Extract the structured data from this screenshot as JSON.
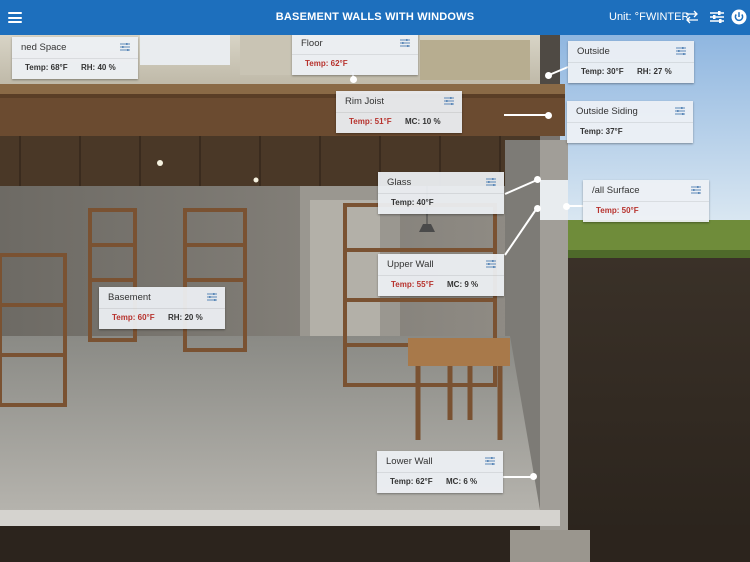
{
  "header": {
    "title": "BASEMENT WALLS WITH WINDOWS",
    "unit_label": "Unit: °F",
    "season_label": "WINTER",
    "menu_icon": "hamburger-menu-icon",
    "swap_icon": "swap-arrows-icon",
    "settings_icon": "sliders-icon",
    "power_icon": "power-icon"
  },
  "colors": {
    "header_bg": "#1d6fbd",
    "warning_red": "#b7322d"
  },
  "cards": {
    "conditioned_space": {
      "name": "ned Space",
      "temp": "Temp: 68°F",
      "rh": "RH: 40 %"
    },
    "floor": {
      "name": "Floor",
      "temp": "Temp: 62°F"
    },
    "outside": {
      "name": "Outside",
      "temp": "Temp: 30°F",
      "rh": "RH: 27 %"
    },
    "rim_joist": {
      "name": "Rim Joist",
      "temp": "Temp: 51°F",
      "mc": "MC: 10 %"
    },
    "outside_siding": {
      "name": "Outside Siding",
      "temp": "Temp: 37°F"
    },
    "glass": {
      "name": "Glass",
      "temp": "Temp: 40°F"
    },
    "wall_surface": {
      "name": "/all Surface",
      "temp": "Temp: 50°F"
    },
    "upper_wall": {
      "name": "Upper Wall",
      "temp": "Temp: 55°F",
      "mc": "MC: 9 %"
    },
    "basement": {
      "name": "Basement",
      "temp": "Temp: 60°F",
      "rh": "RH: 20 %"
    },
    "lower_wall": {
      "name": "Lower Wall",
      "temp": "Temp: 62°F",
      "mc": "MC: 6 %"
    }
  }
}
